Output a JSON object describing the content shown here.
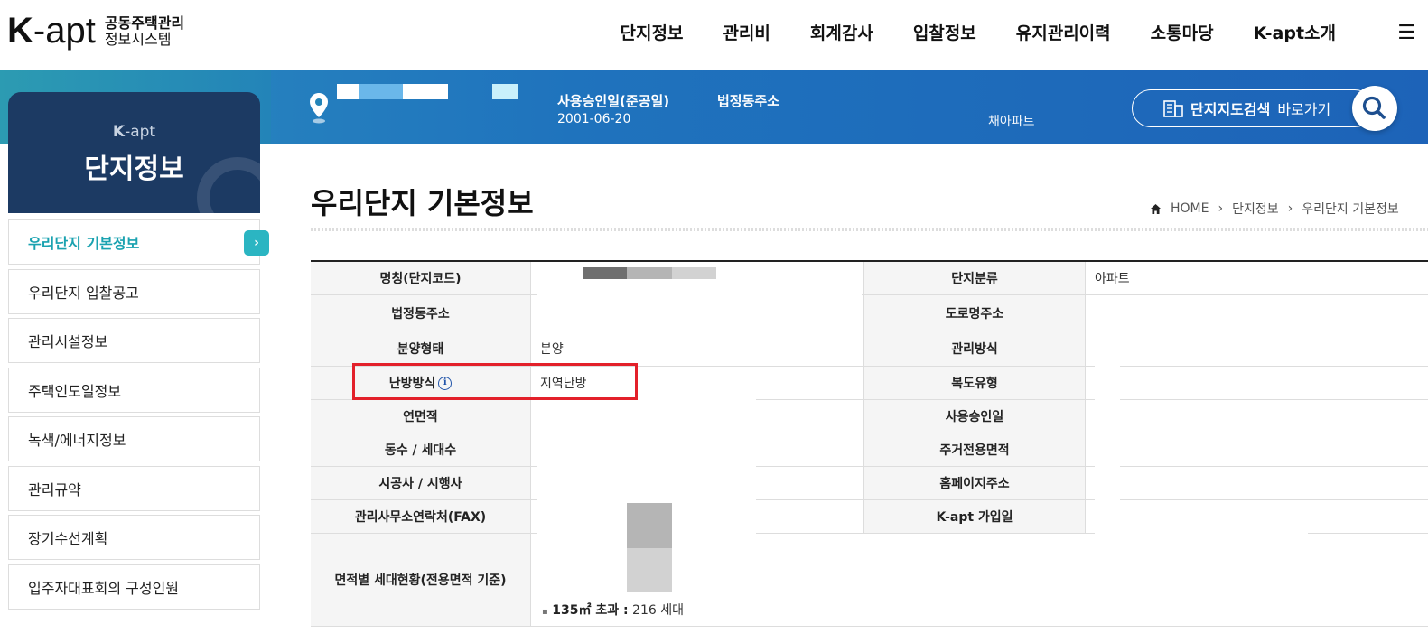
{
  "logo": {
    "mark_k": "K",
    "mark_apt": "-apt",
    "line1": "공동주택관리",
    "line2": "정보시스템"
  },
  "gnb": [
    "단지정보",
    "관리비",
    "회계감사",
    "입찰정보",
    "유지관리이력",
    "소통마당",
    "K-apt소개"
  ],
  "menu_icon": "☰",
  "band": {
    "approval_label": "사용승인일(준공일)",
    "approval_value": "2001-06-20",
    "address_label": "법정동주소",
    "address_value": "채아파트",
    "map_bold": "단지지도검색",
    "map_text": "바로가기"
  },
  "sidebar": {
    "k_prefix": "K",
    "k_suffix": "-apt",
    "title": "단지정보",
    "items": [
      {
        "label": "우리단지 기본정보",
        "active": true
      },
      {
        "label": "우리단지 입찰공고"
      },
      {
        "label": "관리시설정보"
      },
      {
        "label": "주택인도일정보"
      },
      {
        "label": "녹색/에너지정보"
      },
      {
        "label": "관리규약"
      },
      {
        "label": "장기수선계획"
      },
      {
        "label": "입주자대표회의 구성인원"
      }
    ]
  },
  "page": {
    "title": "우리단지 기본정보",
    "breadcrumb": [
      "HOME",
      "단지정보",
      "우리단지 기본정보"
    ]
  },
  "table": {
    "rows": [
      {
        "left_label": "명칭(단지코드)",
        "left_value": "",
        "right_label": "단지분류",
        "right_value": "아파트"
      },
      {
        "left_label": "법정동주소",
        "left_value": "",
        "right_label": "도로명주소",
        "right_value": ""
      },
      {
        "left_label": "분양형태",
        "left_value": "분양",
        "right_label": "관리방식",
        "right_value": ""
      },
      {
        "left_label": "난방방식",
        "left_value": "지역난방",
        "right_label": "복도유형",
        "right_value": ""
      },
      {
        "left_label": "연면적",
        "left_value": "",
        "right_label": "사용승인일",
        "right_value": ""
      },
      {
        "left_label": "동수 / 세대수",
        "left_value": "",
        "right_label": "주거전용면적",
        "right_value": ""
      },
      {
        "left_label": "시공사 / 시행사",
        "left_value": "",
        "right_label": "홈페이지주소",
        "right_value": ""
      },
      {
        "left_label": "관리사무소연락처(FAX)",
        "left_value": "",
        "right_label": "K-apt 가입일",
        "right_value": ""
      }
    ],
    "area_label": "면적별 세대현황(전용면적 기준)",
    "area_bullet_strong": "135㎡ 초과 :",
    "area_bullet_value": "216 세대"
  }
}
